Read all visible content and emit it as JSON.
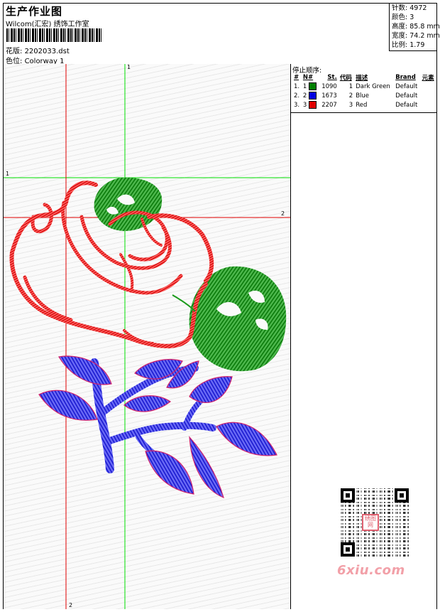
{
  "header": {
    "title": "生产作业图",
    "company": "Wilcom(汇宏) 绣饰工作室",
    "pattern_label": "花版:",
    "pattern_value": "2202033.dst",
    "colorway_label": "色位:",
    "colorway_value": "Colorway 1"
  },
  "stats": [
    {
      "label": "针数:",
      "value": "4972"
    },
    {
      "label": "颜色:",
      "value": "3"
    },
    {
      "label": "高度:",
      "value": "85.8 mm"
    },
    {
      "label": "宽度:",
      "value": "74.2 mm"
    },
    {
      "label": "比例:",
      "value": "1.79"
    }
  ],
  "stop_sequence": {
    "title": "停止顺序:",
    "columns": [
      "#",
      "N#",
      "St.",
      "代码",
      "描述",
      "Brand",
      "元素"
    ],
    "rows": [
      {
        "index": "1.",
        "n": "1",
        "color": "#008000",
        "stitches": "1090",
        "code": "1",
        "description": "Dark Green",
        "brand": "Default"
      },
      {
        "index": "2.",
        "n": "2",
        "color": "#0000e0",
        "stitches": "1673",
        "code": "2",
        "description": "Blue",
        "brand": "Default"
      },
      {
        "index": "3.",
        "n": "3",
        "color": "#e00000",
        "stitches": "2207",
        "code": "3",
        "description": "Red",
        "brand": "Default"
      }
    ]
  },
  "guides": {
    "v1": "1",
    "h1": "1",
    "h2": "2",
    "v2": "2"
  },
  "colors": {
    "green": "#1a9a1a",
    "blue": "#2a2ae0",
    "red": "#e01010",
    "guide_green": "#00e000",
    "guide_red": "#e00000"
  },
  "watermark": {
    "text": "6xiu.com",
    "badge": "绣图网"
  }
}
